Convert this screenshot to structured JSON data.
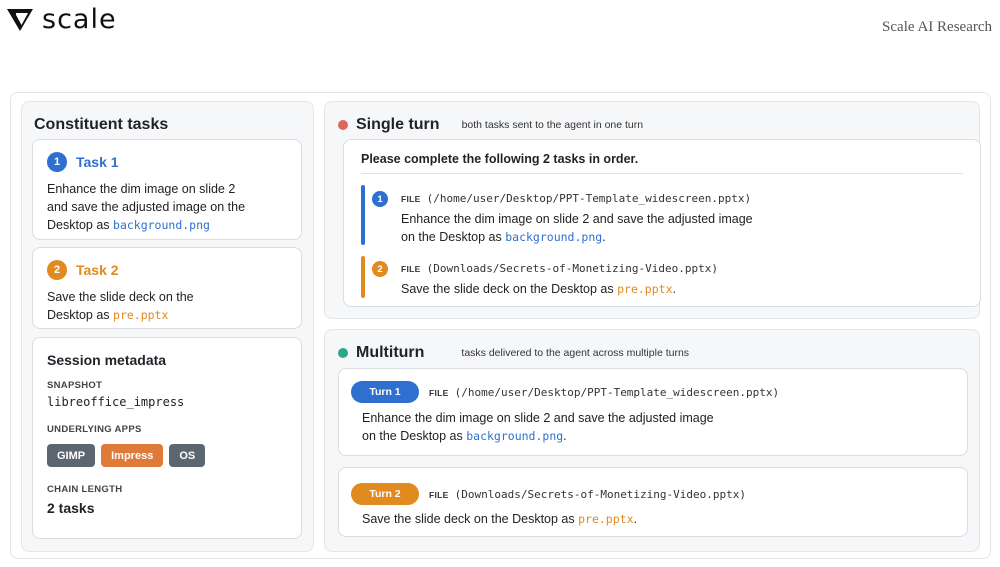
{
  "header": {
    "logo_text": "scale",
    "tagline": "Scale AI Research"
  },
  "left": {
    "title": "Constituent tasks",
    "tasks": [
      {
        "number": "1",
        "name": "Task 1",
        "desc_line1": "Enhance the dim image on slide 2",
        "desc_line2": "and save the adjusted image on the",
        "desc_line3_prefix": "Desktop as ",
        "file": "background.png"
      },
      {
        "number": "2",
        "name": "Task 2",
        "desc_line1": "Save the slide deck on the",
        "desc_line2_prefix": "Desktop as ",
        "file": "pre.pptx"
      }
    ],
    "metadata": {
      "title": "Session metadata",
      "snapshot_label": "SNAPSHOT",
      "snapshot_value": "libreoffice_impress",
      "apps_label": "UNDERLYING APPS",
      "apps": [
        "GIMP",
        "Impress",
        "OS"
      ],
      "chain_label": "CHAIN LENGTH",
      "chain_value": "2 tasks"
    }
  },
  "single_turn": {
    "title": "Single turn",
    "subtitle": "both tasks sent to the agent in one turn",
    "prompt_title": "Please complete the following 2 tasks in order.",
    "items": [
      {
        "number": "1",
        "file_tag": "FILE",
        "file_path": "(/home/user/Desktop/PPT-Template_widescreen.pptx)",
        "text_line1": "Enhance the dim image on slide 2 and save the adjusted image",
        "text_line2_prefix": "on the Desktop as ",
        "file": "background.png",
        "suffix": "."
      },
      {
        "number": "2",
        "file_tag": "FILE",
        "file_path": "(Downloads/Secrets-of-Monetizing-Video.pptx)",
        "text_prefix": "Save the slide deck on the Desktop as ",
        "file": "pre.pptx",
        "suffix": "."
      }
    ]
  },
  "multiturn": {
    "title": "Multiturn",
    "subtitle": "tasks delivered to the agent across multiple turns",
    "turns": [
      {
        "label": "Turn 1",
        "file_tag": "FILE",
        "file_path": "(/home/user/Desktop/PPT-Template_widescreen.pptx)",
        "text_line1": "Enhance the dim image on slide 2 and save the adjusted image",
        "text_line2_prefix": "on the Desktop as ",
        "file": "background.png",
        "suffix": "."
      },
      {
        "label": "Turn 2",
        "file_tag": "FILE",
        "file_path": "(Downloads/Secrets-of-Monetizing-Video.pptx)",
        "text_prefix": "Save the slide deck on the Desktop as ",
        "file": "pre.pptx",
        "suffix": "."
      }
    ]
  },
  "colors": {
    "task1": "#2f6fd0",
    "task2": "#e08a1f",
    "single_turn_dot": "#e0665a",
    "multiturn_dot": "#2fa58e"
  }
}
